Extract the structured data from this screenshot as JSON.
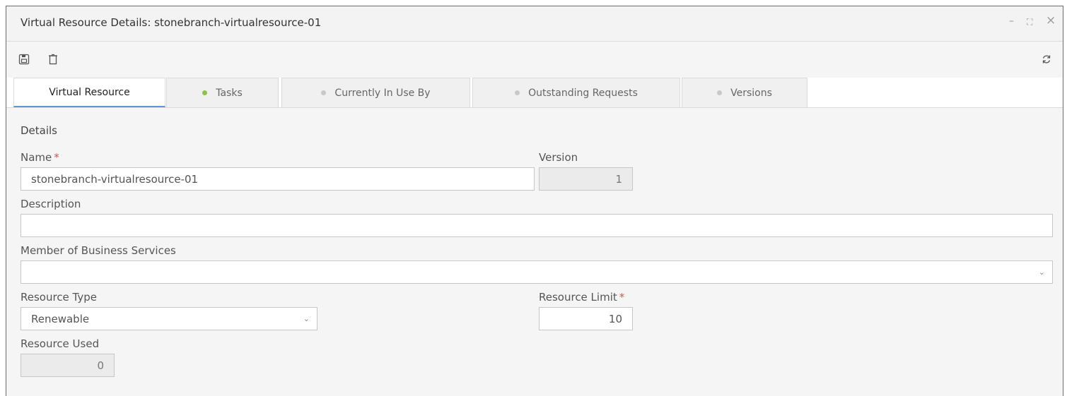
{
  "window": {
    "title": "Virtual Resource Details: stonebranch-virtualresource-01",
    "controls": {
      "minimize": "–",
      "maximize": "⛶",
      "close": "×"
    }
  },
  "toolbar": {
    "icons": [
      "save-icon",
      "delete-icon",
      "refresh-icon"
    ]
  },
  "tabs": [
    {
      "label": "Virtual Resource",
      "active": true,
      "dot": null
    },
    {
      "label": "Tasks",
      "active": false,
      "dot": "#8bc34a"
    },
    {
      "label": "Currently In Use By",
      "active": false,
      "dot": "#c8c8c8"
    },
    {
      "label": "Outstanding Requests",
      "active": false,
      "dot": "#c8c8c8"
    },
    {
      "label": "Versions",
      "active": false,
      "dot": "#c8c8c8"
    }
  ],
  "details": {
    "section_title": "Details",
    "name_label": "Name",
    "required_marker": "*",
    "name_value": "stonebranch-virtualresource-01",
    "version_label": "Version",
    "version_value": "1",
    "description_label": "Description",
    "description_value": "",
    "member_label": "Member of Business Services",
    "member_value": "",
    "resource_type_label": "Resource Type",
    "resource_type_value": "Renewable",
    "resource_limit_label": "Resource Limit",
    "resource_limit_value": "10",
    "resource_used_label": "Resource Used",
    "resource_used_value": "0"
  },
  "colors": {
    "accent": "#5b9bd5",
    "required": "#e05050",
    "tasks_dot": "#8bc34a"
  }
}
